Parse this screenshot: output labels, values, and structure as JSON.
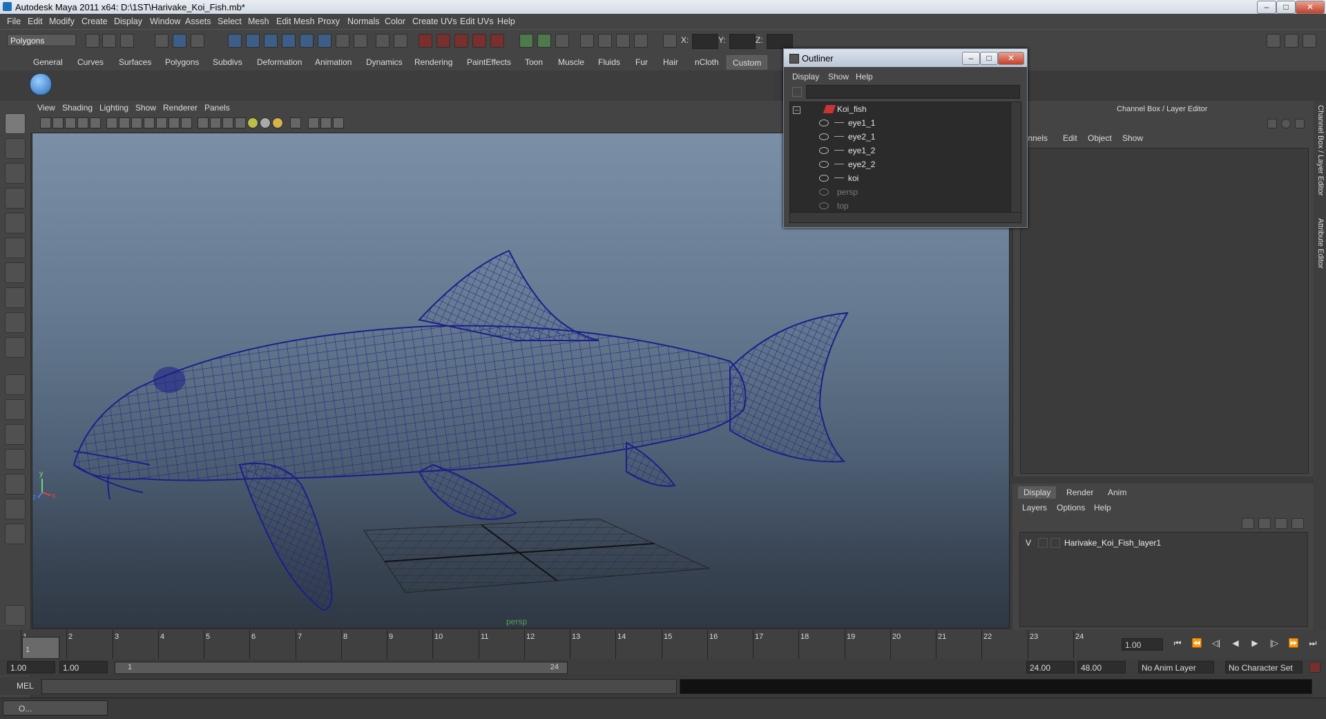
{
  "window": {
    "title": "Autodesk Maya 2011 x64: D:\\1ST\\Harivake_Koi_Fish.mb*"
  },
  "menubar": [
    "File",
    "Edit",
    "Modify",
    "Create",
    "Display",
    "Window",
    "Assets",
    "Select",
    "Mesh",
    "Edit Mesh",
    "Proxy",
    "Normals",
    "Color",
    "Create UVs",
    "Edit UVs",
    "Help"
  ],
  "status": {
    "mode": "Polygons",
    "x_label": "X:",
    "y_label": "Y:",
    "z_label": "Z:"
  },
  "shelf_tabs": [
    "General",
    "Curves",
    "Surfaces",
    "Polygons",
    "Subdivs",
    "Deformation",
    "Animation",
    "Dynamics",
    "Rendering",
    "PaintEffects",
    "Toon",
    "Muscle",
    "Fluids",
    "Fur",
    "Hair",
    "nCloth",
    "Custom"
  ],
  "shelf_active": "Custom",
  "viewport": {
    "menus": [
      "View",
      "Shading",
      "Lighting",
      "Show",
      "Renderer",
      "Panels"
    ],
    "camera_label": "persp",
    "axis_y": "y",
    "axis_x": "x",
    "axis_z": "z"
  },
  "outliner": {
    "title": "Outliner",
    "menus": [
      "Display",
      "Show",
      "Help"
    ],
    "items": [
      {
        "label": "Koi_fish",
        "indent": 0,
        "dim": false
      },
      {
        "label": "eye1_1",
        "indent": 1,
        "dim": false
      },
      {
        "label": "eye2_1",
        "indent": 1,
        "dim": false
      },
      {
        "label": "eye1_2",
        "indent": 1,
        "dim": false
      },
      {
        "label": "eye2_2",
        "indent": 1,
        "dim": false
      },
      {
        "label": "koi",
        "indent": 1,
        "dim": false
      },
      {
        "label": "persp",
        "indent": 0,
        "dim": true
      },
      {
        "label": "top",
        "indent": 0,
        "dim": true
      }
    ]
  },
  "channelbox": {
    "title": "Channel Box / Layer Editor",
    "menus": [
      "hannels",
      "Edit",
      "Object",
      "Show"
    ]
  },
  "sidetabs": [
    "Channel Box / Layer Editor",
    "Attribute Editor"
  ],
  "layers": {
    "tabs": [
      "Display",
      "Render",
      "Anim"
    ],
    "active_tab": "Display",
    "menus": [
      "Layers",
      "Options",
      "Help"
    ],
    "layer_visible": "V",
    "layer_name": "Harivake_Koi_Fish_layer1"
  },
  "timeslider": {
    "ticks": [
      "1",
      "2",
      "3",
      "4",
      "5",
      "6",
      "7",
      "8",
      "9",
      "10",
      "11",
      "12",
      "13",
      "14",
      "15",
      "16",
      "17",
      "18",
      "19",
      "20",
      "21",
      "22",
      "23",
      "24"
    ],
    "current_frame_marker": "1",
    "current_time": "1.00"
  },
  "range": {
    "start": "1.00",
    "playback_start": "1.00",
    "range_start_label": "1",
    "range_end_label": "24",
    "playback_end": "24.00",
    "end": "48.00",
    "anim_layer": "No Anim Layer",
    "char_set": "No Character Set"
  },
  "cmdline": {
    "label": "MEL"
  },
  "taskbar": {
    "label": "O..."
  }
}
